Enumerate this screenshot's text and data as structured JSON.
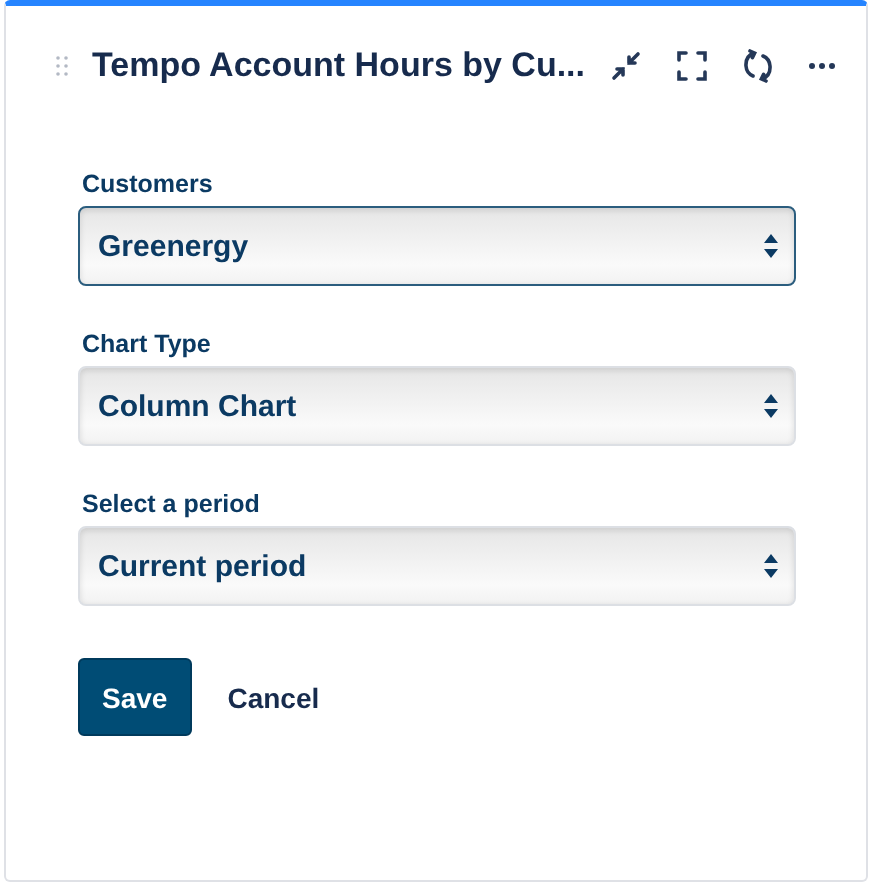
{
  "gadget": {
    "title": "Tempo Account Hours by Cu..."
  },
  "fields": [
    {
      "label": "Customers",
      "value": "Greenergy",
      "focused": true
    },
    {
      "label": "Chart Type",
      "value": "Column Chart",
      "focused": false
    },
    {
      "label": "Select a period",
      "value": "Current period",
      "focused": false
    }
  ],
  "buttons": [
    {
      "label": "Save",
      "kind": "primary"
    },
    {
      "label": "Cancel",
      "kind": "link"
    }
  ]
}
